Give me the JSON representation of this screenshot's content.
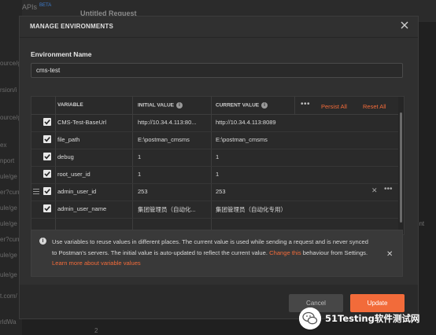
{
  "background": {
    "apis_label": "APIs",
    "apis_badge": "BETA",
    "request_tab": "Untitled Request",
    "sidebar_fragments": [
      "ource/g",
      "rsion/i",
      "ource/g",
      "ex",
      "nport",
      "ule/ge",
      "er?curr",
      "ule/ge",
      "ule/ge",
      "er?curr",
      "ule/ge",
      "ule/ge",
      "t.com/",
      "rldWa"
    ],
    "right_fragment": "ent",
    "bottom_fragment": "2"
  },
  "modal": {
    "title": "MANAGE ENVIRONMENTS",
    "env_name_label": "Environment Name",
    "env_name_value": "cms-test",
    "table": {
      "headers": {
        "variable": "VARIABLE",
        "initial": "INITIAL VALUE",
        "current": "CURRENT VALUE",
        "persist_all": "Persist All",
        "reset_all": "Reset All",
        "more": "•••"
      },
      "rows": [
        {
          "checked": true,
          "variable": "CMS-Test-BaseUrl",
          "initial": "http://10.34.4.113:80...",
          "current": "http://10.34.4.113:8089"
        },
        {
          "checked": true,
          "variable": "file_path",
          "initial": "E:\\postman_cmsms",
          "current": "E:\\postman_cmsms"
        },
        {
          "checked": true,
          "variable": "debug",
          "initial": "1",
          "current": "1"
        },
        {
          "checked": true,
          "variable": "root_user_id",
          "initial": "1",
          "current": "1"
        },
        {
          "checked": true,
          "variable": "admin_user_id",
          "initial": "253",
          "current": "253"
        },
        {
          "checked": true,
          "variable": "admin_user_name",
          "initial": "集团管理员（自动化...",
          "current": "集团管理员（自动化专用）"
        }
      ]
    },
    "banner": {
      "text": "Use variables to reuse values in different places. The current value is used while sending a request and is never synced to Postman's servers. The initial value is auto-updated to reflect the current value.",
      "link_change": "Change this",
      "text_after": "behaviour from Settings.",
      "link_learn": "Learn more about variable values"
    },
    "footer": {
      "cancel_label": "Cancel",
      "update_label": "Update"
    }
  },
  "watermark": {
    "text": "51Testing软件测试网"
  },
  "colors": {
    "accent": "#f26b3a",
    "modal_bg": "#303030",
    "table_bg": "#2a2a2a"
  }
}
